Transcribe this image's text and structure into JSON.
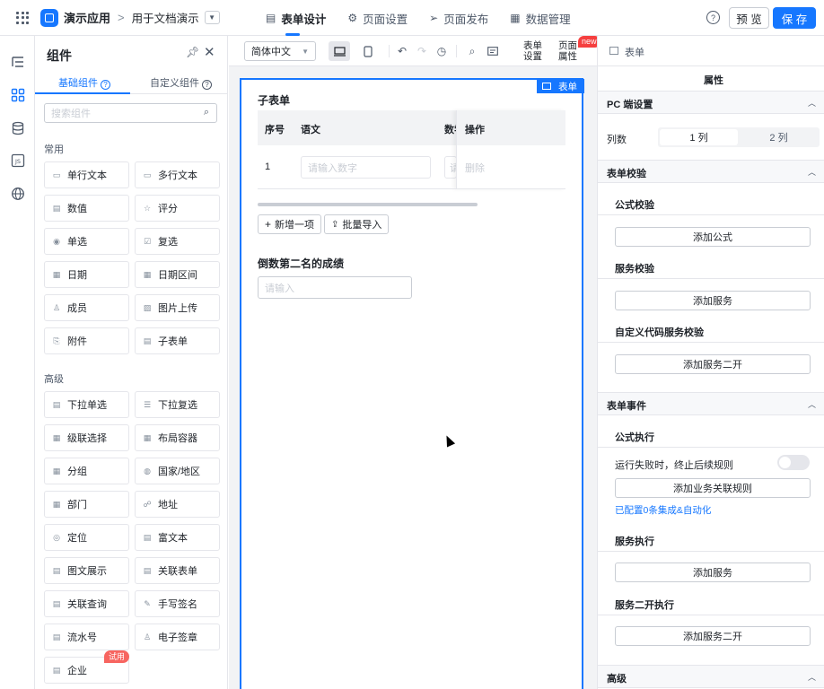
{
  "header": {
    "app_name": "演示应用",
    "breadcrumb_sep": ">",
    "doc_name": "用于文档演示",
    "tabs": [
      {
        "label": "表单设计",
        "icon": "document-icon"
      },
      {
        "label": "页面设置",
        "icon": "gear-icon"
      },
      {
        "label": "页面发布",
        "icon": "send-icon"
      },
      {
        "label": "数据管理",
        "icon": "table-icon"
      }
    ],
    "help": "?",
    "preview_label": "预 览",
    "save_label": "保 存"
  },
  "components_panel": {
    "title": "组件",
    "tabs": [
      {
        "label": "基础组件"
      },
      {
        "label": "自定义组件"
      }
    ],
    "search_placeholder": "搜索组件",
    "common_label": "常用",
    "common": [
      {
        "label": "单行文本"
      },
      {
        "label": "多行文本"
      },
      {
        "label": "数值"
      },
      {
        "label": "评分"
      },
      {
        "label": "单选"
      },
      {
        "label": "复选"
      },
      {
        "label": "日期"
      },
      {
        "label": "日期区间"
      },
      {
        "label": "成员"
      },
      {
        "label": "图片上传"
      },
      {
        "label": "附件"
      },
      {
        "label": "子表单"
      }
    ],
    "advanced_label": "高级",
    "advanced": [
      {
        "label": "下拉单选"
      },
      {
        "label": "下拉复选"
      },
      {
        "label": "级联选择"
      },
      {
        "label": "布局容器"
      },
      {
        "label": "分组"
      },
      {
        "label": "国家/地区"
      },
      {
        "label": "部门"
      },
      {
        "label": "地址"
      },
      {
        "label": "定位"
      },
      {
        "label": "富文本"
      },
      {
        "label": "图文展示"
      },
      {
        "label": "关联表单"
      },
      {
        "label": "关联查询"
      },
      {
        "label": "手写签名"
      },
      {
        "label": "流水号"
      },
      {
        "label": "电子签章"
      },
      {
        "label": "企业"
      }
    ],
    "trial_badge": "试用"
  },
  "toolbar": {
    "language": "简体中文",
    "form_settings": [
      "表单",
      "设置"
    ],
    "page_props": [
      "页面",
      "属性"
    ],
    "new_badge": "new"
  },
  "canvas": {
    "form_tag": "表单",
    "subform_title": "子表单",
    "columns": [
      "序号",
      "语文",
      "数学",
      "操作"
    ],
    "row": {
      "index": "1",
      "placeholder": "请输入数字",
      "placeholder_partial": "请",
      "delete": "删除"
    },
    "add_item": "新增一项",
    "bulk_import": "批量导入",
    "field_label": "倒数第二名的成绩",
    "field_placeholder": "请输入"
  },
  "props": {
    "header_title": "表单",
    "tab": "属性",
    "pc_section": "PC 端设置",
    "columns_label": "列数",
    "col_options": [
      "1 列",
      "2 列"
    ],
    "validation_section": "表单校验",
    "formula_validation": "公式校验",
    "add_formula": "添加公式",
    "service_validation": "服务校验",
    "add_service": "添加服务",
    "custom_code_validation": "自定义代码服务校验",
    "add_service_secondary": "添加服务二开",
    "events_section": "表单事件",
    "formula_exec": "公式执行",
    "stop_on_fail": "运行失败时，终止后续规则",
    "add_rule": "添加业务关联规则",
    "configured_link": "已配置0条集成&自动化",
    "service_exec": "服务执行",
    "add_service2": "添加服务",
    "service_secondary_exec": "服务二开执行",
    "add_service_secondary2": "添加服务二开",
    "advanced_section": "高级"
  }
}
